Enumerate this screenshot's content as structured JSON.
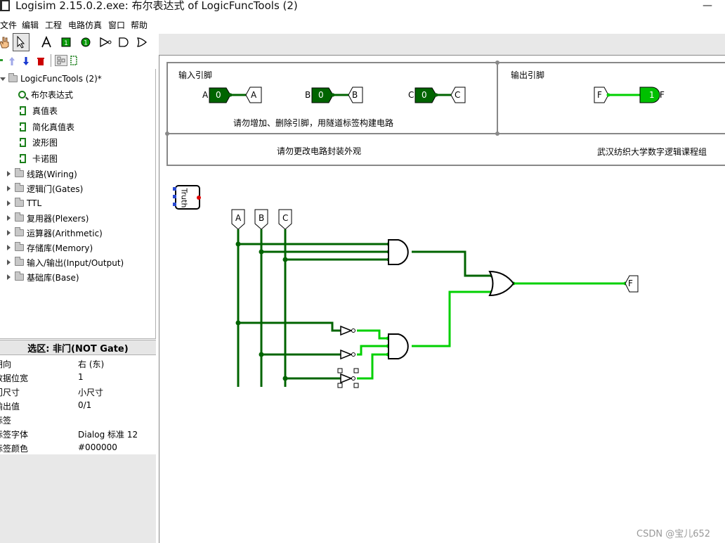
{
  "window": {
    "title": "Logisim 2.15.0.2.exe: 布尔表达式 of LogicFuncTools (2)",
    "minimize_glyph": "—"
  },
  "menu": [
    "文件",
    "编辑",
    "工程",
    "电路仿真",
    "窗口",
    "帮助"
  ],
  "tree": {
    "project": "LogicFuncTools (2)*",
    "circuits": [
      "布尔表达式",
      "真值表",
      "简化真值表",
      "波形图",
      "卡诺图"
    ],
    "libraries": [
      "线路(Wiring)",
      "逻辑门(Gates)",
      "TTL",
      "复用器(Plexers)",
      "运算器(Arithmetic)",
      "存储库(Memory)",
      "输入/输出(Input/Output)",
      "基础库(Base)"
    ]
  },
  "selection": {
    "header": "选区: 非门(NOT Gate)",
    "attributes": [
      {
        "key": "朝向",
        "value": "右 (东)"
      },
      {
        "key": "数据位宽",
        "value": "1"
      },
      {
        "key": "门尺寸",
        "value": "小尺寸"
      },
      {
        "key": "输出值",
        "value": "0/1"
      },
      {
        "key": "标签",
        "value": ""
      },
      {
        "key": "标签字体",
        "value": "Dialog 标准 12"
      },
      {
        "key": "标签颜色",
        "value": "#000000"
      }
    ]
  },
  "canvas": {
    "input_pins_title": "输入引脚",
    "output_pins_title": "输出引脚",
    "pin_rule_text": "请勿增加、删除引脚，用隧道标签构建电路",
    "appearance_rule_text": "请勿更改电路封装外观",
    "credit_text": "武汉纺织大学数字逻辑课程组",
    "inputs": [
      {
        "name": "A",
        "value": "0",
        "tunnel": "A"
      },
      {
        "name": "B",
        "value": "0",
        "tunnel": "B"
      },
      {
        "name": "C",
        "value": "0",
        "tunnel": "C"
      }
    ],
    "output": {
      "name": "F",
      "value": "1",
      "tunnel": "F"
    },
    "truth_block_label": "Truth",
    "circuit_tunnels": [
      "A",
      "B",
      "C"
    ],
    "output_tunnel": "F"
  },
  "colors": {
    "wire_dark": "#006400",
    "wire_bright": "#00d000",
    "pin_fill": "#006400"
  },
  "watermark": "CSDN @宝儿652"
}
